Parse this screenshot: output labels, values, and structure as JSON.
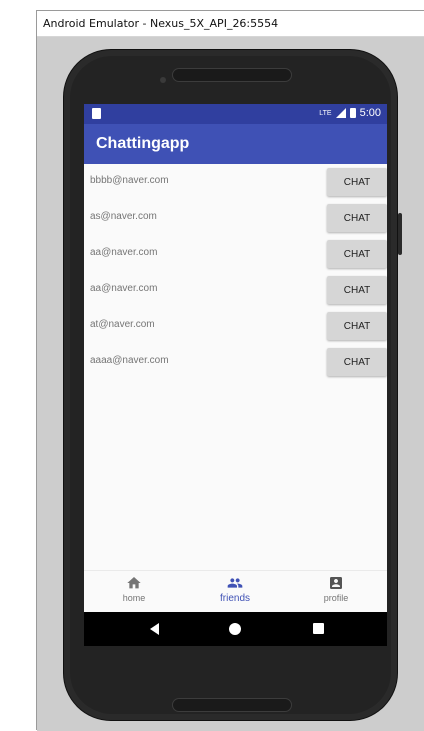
{
  "window": {
    "title": "Android Emulator - Nexus_5X_API_26:5554"
  },
  "status_bar": {
    "network": "LTE",
    "time": "5:00"
  },
  "app_bar": {
    "title": "Chattingapp"
  },
  "friends": [
    {
      "email": "bbbb@naver.com",
      "button": "CHAT"
    },
    {
      "email": "as@naver.com",
      "button": "CHAT"
    },
    {
      "email": "aa@naver.com",
      "button": "CHAT"
    },
    {
      "email": "aa@naver.com",
      "button": "CHAT"
    },
    {
      "email": "at@naver.com",
      "button": "CHAT"
    },
    {
      "email": "aaaa@naver.com",
      "button": "CHAT"
    }
  ],
  "bottom_nav": {
    "items": [
      {
        "label": "home",
        "icon": "home-icon",
        "active": false
      },
      {
        "label": "friends",
        "icon": "people-icon",
        "active": true
      },
      {
        "label": "profile",
        "icon": "account-box-icon",
        "active": false
      }
    ]
  },
  "colors": {
    "primary": "#3f51b5",
    "primary_dark": "#303f9f",
    "button_bg": "#d6d6d6"
  }
}
